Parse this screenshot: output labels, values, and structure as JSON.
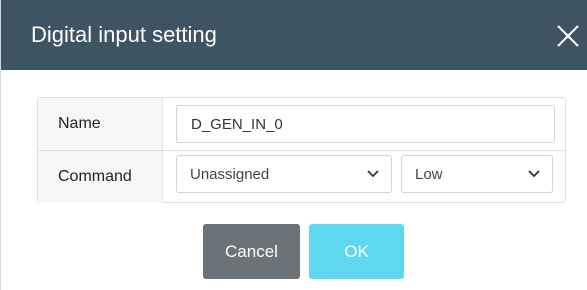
{
  "dialog": {
    "title": "Digital input setting",
    "close_icon": "close-icon"
  },
  "form": {
    "name_label": "Name",
    "name_value": "D_GEN_IN_0",
    "command_label": "Command",
    "command_value": "Unassigned",
    "level_value": "Low",
    "dropdown_icon": "chevron-down-icon"
  },
  "buttons": {
    "cancel_label": "Cancel",
    "ok_label": "OK"
  },
  "colors": {
    "titlebar": "#3e5462",
    "cancel": "#6b7379",
    "ok": "#5fd7ee"
  }
}
